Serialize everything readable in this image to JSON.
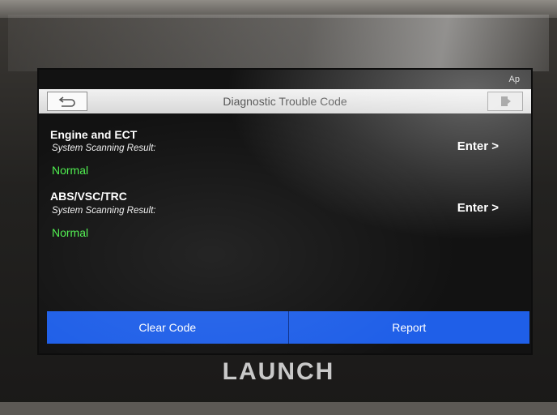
{
  "statusbar": {
    "text": "Ap"
  },
  "header": {
    "title": "Diagnostic Trouble Code",
    "back_icon": "back-arrow-icon",
    "exit_icon": "exit-door-icon"
  },
  "systems": [
    {
      "name": "Engine and ECT",
      "label": "System Scanning Result:",
      "status": "Normal",
      "enter": "Enter >"
    },
    {
      "name": "ABS/VSC/TRC",
      "label": "System Scanning Result:",
      "status": "Normal",
      "enter": "Enter >"
    }
  ],
  "buttons": {
    "clear_code": "Clear Code",
    "report": "Report"
  },
  "device": {
    "brand": "LAUNCH"
  },
  "colors": {
    "accent_blue": "#1f5fe8",
    "normal_green": "#4ef04e",
    "screen_bg": "#121212"
  }
}
